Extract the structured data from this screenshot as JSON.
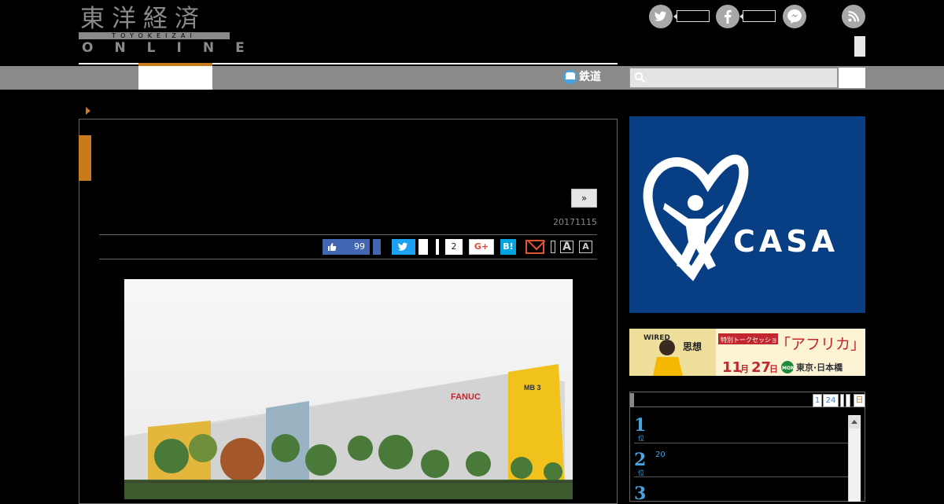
{
  "header": {
    "logo_kanji": "東洋経済",
    "logo_romaji": "TOYOKEIZAI",
    "logo_online": "ONLINE"
  },
  "social": {
    "twitter_icon": "twitter-icon",
    "facebook_icon": "facebook-icon",
    "messenger_icon": "messenger-icon",
    "rss_icon": "rss-icon"
  },
  "nav": {
    "rail_label": "鉄道",
    "search_icon": "search-icon"
  },
  "article": {
    "next_label": "»",
    "date": "20171115",
    "share": {
      "like_count": "99",
      "pocket_count": "2",
      "gplus_label": "G+",
      "hatena_label": "B!",
      "font_large": "A",
      "font_small": "A"
    },
    "photo": {
      "sign_left": "FANUC",
      "sign_right": "MB 3"
    }
  },
  "sidebar": {
    "casa_ad": {
      "text": "CASA",
      "reg": "®",
      "bg": "#083e84"
    },
    "africa_ad": {
      "logo_letters": "WIRED",
      "shisou": "思想",
      "session": "特別トークセッション",
      "title": "「アフリカ」",
      "date_num": "11",
      "date_month": "月",
      "date_day": "27",
      "date_suffix": "日",
      "weekday": "MON",
      "place": "東京·日本橋"
    },
    "ranking": {
      "tabs": [
        "1",
        "24"
      ],
      "last_tab": "日",
      "items": [
        {
          "num": "1",
          "sub": "位",
          "text": ""
        },
        {
          "num": "2",
          "sub": "位",
          "text": "20"
        },
        {
          "num": "3",
          "sub": "",
          "text": ""
        }
      ]
    }
  },
  "colors": {
    "accent": "#c97a1b",
    "nav": "#8a8a8a",
    "facebook": "#4266b2",
    "twitter": "#1da1f2"
  }
}
